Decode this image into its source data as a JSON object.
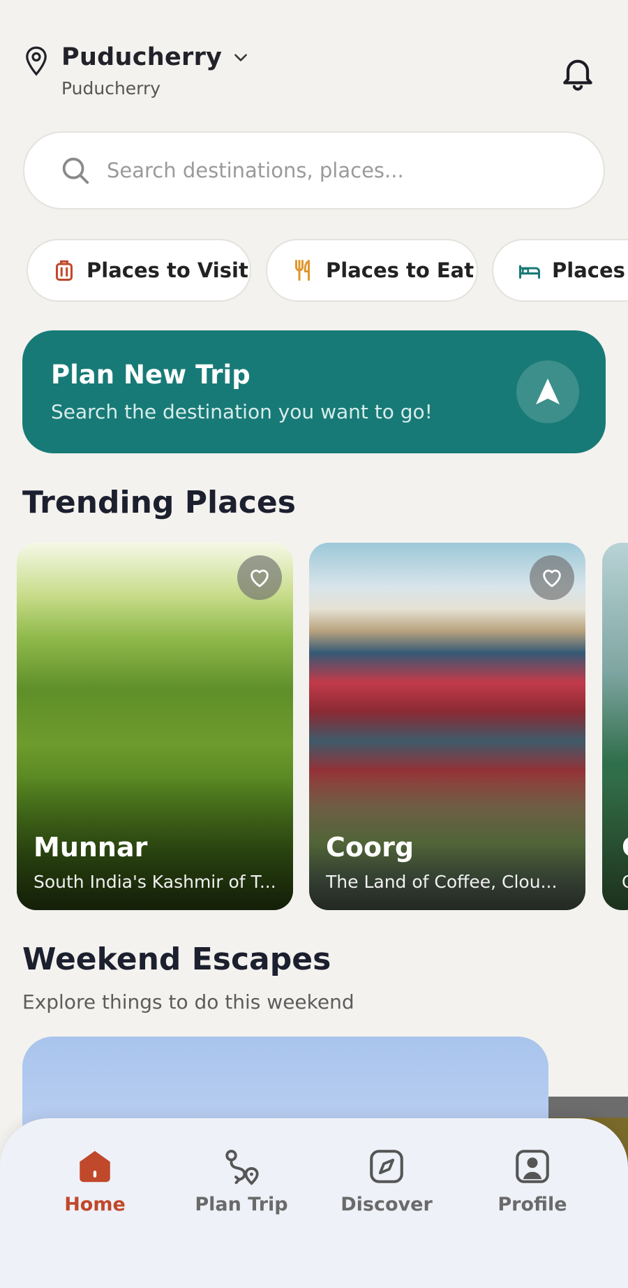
{
  "header": {
    "location_title": "Puducherry",
    "location_subtitle": "Puducherry"
  },
  "search": {
    "placeholder": "Search destinations, places..."
  },
  "categories": [
    {
      "label": "Places to Visit",
      "icon": "luggage-icon",
      "color": "#c0482b"
    },
    {
      "label": "Places to Eat",
      "icon": "fork-knife-icon",
      "color": "#e0972e"
    },
    {
      "label": "Places t",
      "icon": "bed-icon",
      "color": "#187a76"
    }
  ],
  "plan_banner": {
    "title": "Plan New Trip",
    "subtitle": "Search the destination you want to go!",
    "icon": "navigation-arrow-icon",
    "color": "#187a76"
  },
  "trending": {
    "heading": "Trending Places",
    "cards": [
      {
        "name": "Munnar",
        "description": "South India's Kashmir of T..."
      },
      {
        "name": "Coorg",
        "description": "The Land of Coffee, Clou..."
      },
      {
        "name": "C",
        "description": "C"
      }
    ]
  },
  "weekend": {
    "heading": "Weekend Escapes",
    "subheading": "Explore things to do this weekend"
  },
  "bottom_nav": {
    "items": [
      {
        "label": "Home",
        "icon": "home-icon",
        "active": true
      },
      {
        "label": "Plan Trip",
        "icon": "route-icon",
        "active": false
      },
      {
        "label": "Discover",
        "icon": "compass-icon",
        "active": false
      },
      {
        "label": "Profile",
        "icon": "profile-icon",
        "active": false
      }
    ],
    "active_color": "#c0482b"
  }
}
